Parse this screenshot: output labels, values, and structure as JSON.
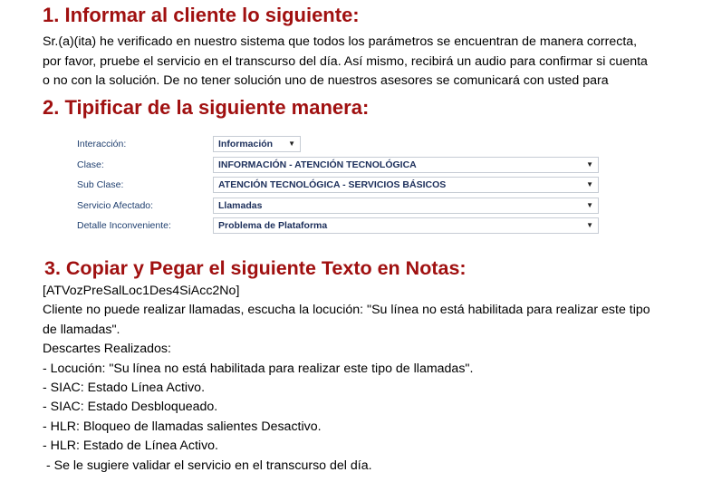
{
  "section1": {
    "heading": "1. Informar al cliente lo siguiente:",
    "lines": [
      "Sr.(a)(ita) he verificado en nuestro sistema que todos los parámetros se encuentran de manera correcta,",
      "por favor, pruebe el servicio en el transcurso del día. Así mismo, recibirá un audio para confirmar si cuenta",
      "o no con la solución. De no tener solución uno de nuestros asesores se comunicará con usted para"
    ]
  },
  "section2": {
    "heading": "2. Tipificar de la siguiente manera:",
    "form": [
      {
        "label": "Interacción:",
        "value": "Información"
      },
      {
        "label": "Clase:",
        "value": "INFORMACIÓN - ATENCIÓN TECNOLÓGICA"
      },
      {
        "label": "Sub Clase:",
        "value": "ATENCIÓN TECNOLÓGICA - SERVICIOS BÁSICOS"
      },
      {
        "label": "Servicio Afectado:",
        "value": "Llamadas"
      },
      {
        "label": "Detalle Inconveniente:",
        "value": "Problema de Plataforma"
      }
    ]
  },
  "section3": {
    "heading": "3. Copiar y Pegar el siguiente Texto en Notas:",
    "lines": [
      "[ATVozPreSalLoc1Des4SiAcc2No]",
      "Cliente no puede realizar llamadas, escucha la locución: \"Su línea no está habilitada para realizar este tipo",
      "de llamadas\".",
      "Descartes Realizados:",
      "- Locución: \"Su línea no está habilitada para realizar este tipo de llamadas\".",
      "- SIAC: Estado Línea Activo.",
      "- SIAC: Estado Desbloqueado.",
      "- HLR: Bloqueo de llamadas salientes Desactivo.",
      "- HLR: Estado de Línea Activo.",
      " - Se le sugiere validar el servicio en el transcurso del día."
    ]
  }
}
